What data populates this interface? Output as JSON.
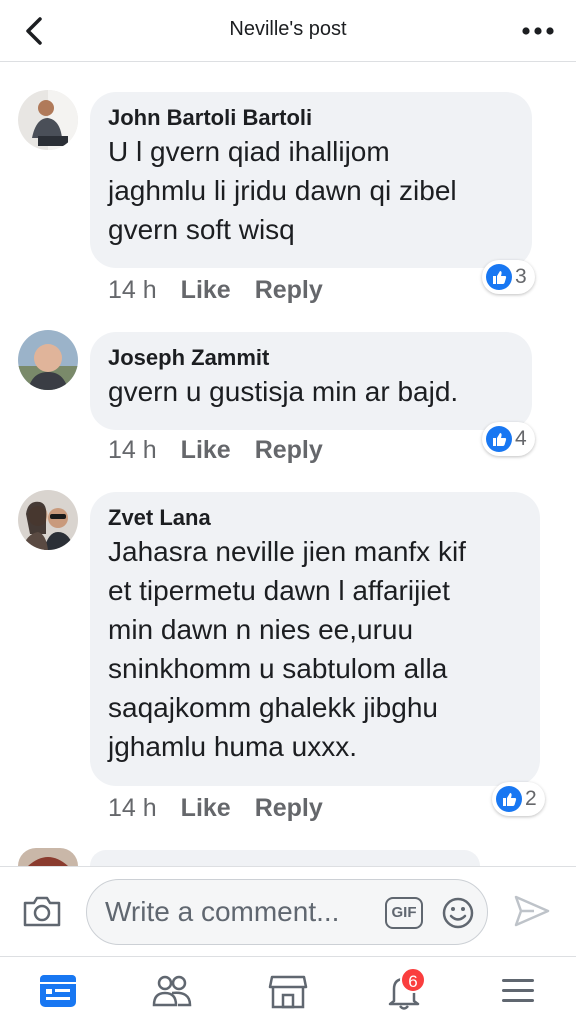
{
  "header": {
    "title": "Neville's post"
  },
  "comments": [
    {
      "author": "John Bartoli Bartoli",
      "text": "U l gvern qiad ihallijom\njaghmlu li jridu dawn qi zibel\ngvern soft wisq",
      "time": "14 h",
      "like_label": "Like",
      "reply_label": "Reply",
      "reaction_count": "3"
    },
    {
      "author": "Joseph Zammit",
      "text": "gvern u gustisja min ar bajd.",
      "time": "14 h",
      "like_label": "Like",
      "reply_label": "Reply",
      "reaction_count": "4"
    },
    {
      "author": "Zvet Lana",
      "text": "Jahasra neville jien manfx kif\net tipermetu dawn l affarijiet\nmin dawn n nies ee,uruu\nsninkhomm u sabtulom alla\nsaqajkomm ghalekk jibghu\njghamlu huma uxxx.",
      "time": "14 h",
      "like_label": "Like",
      "reply_label": "Reply",
      "reaction_count": "2"
    }
  ],
  "composer": {
    "placeholder": "Write a comment...",
    "gif_label": "GIF"
  },
  "nav": {
    "notifications_badge": "6"
  },
  "colors": {
    "accent": "#1877f2",
    "bubble": "#f0f2f5",
    "meta": "#65676b",
    "badge": "#fa3e3e"
  }
}
